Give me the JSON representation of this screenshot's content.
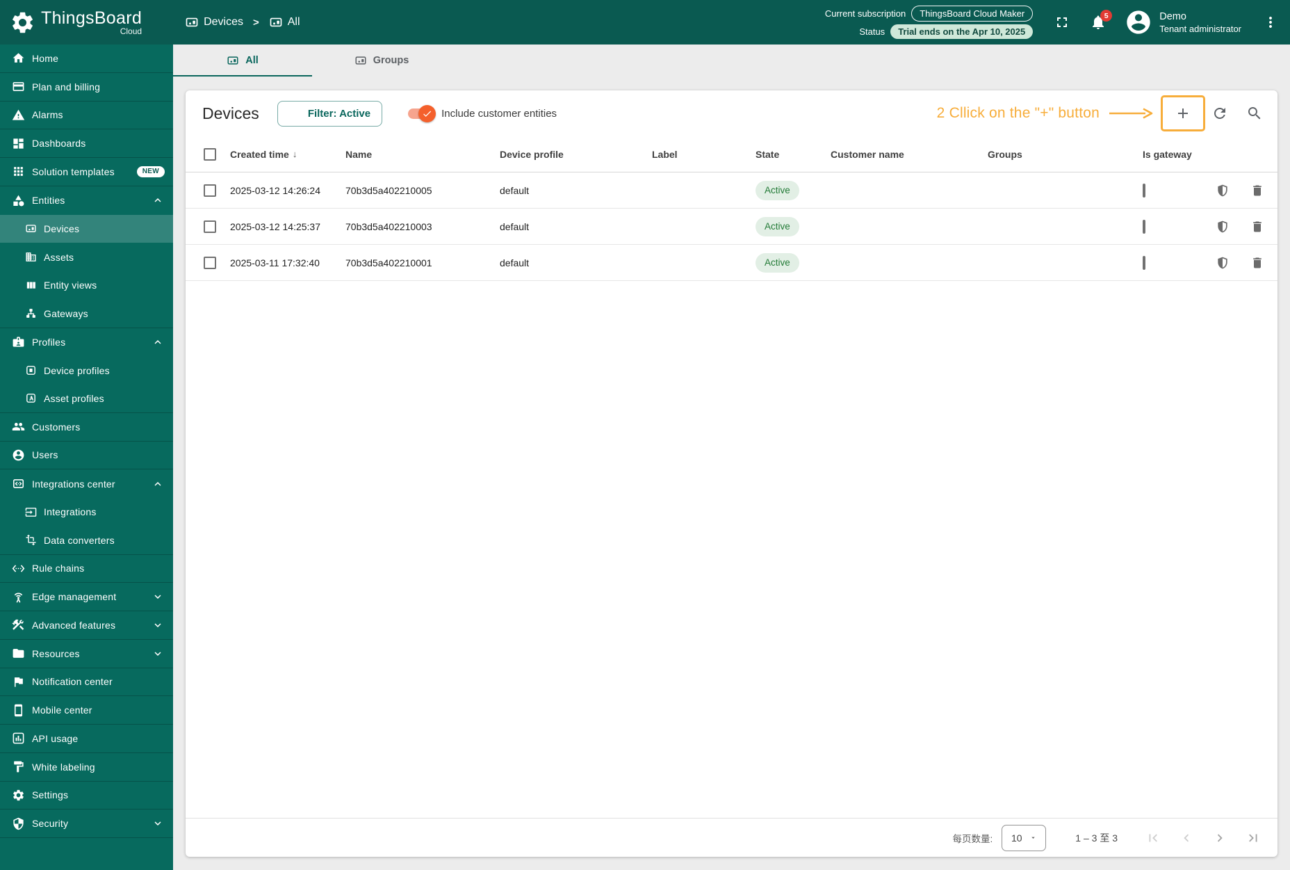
{
  "colors": {
    "header_bg": "#0a5a51",
    "sidebar_bg": "#076a5e",
    "brand_teal": "#09665c",
    "annotation_orange": "#f7ad3a",
    "toggle_track": "#f6a48e",
    "toggle_thumb": "#f4602c",
    "active_chip_bg": "#e2efe5",
    "active_chip_text": "#237b37",
    "badge_red": "#e23b34",
    "status_chip_bg": "#cfe8d9",
    "status_chip_text": "#11493e"
  },
  "header": {
    "logo_title": "ThingsBoard",
    "logo_subtitle": "Cloud",
    "breadcrumb": {
      "level1": "Devices",
      "level2": "All"
    },
    "subscription_label": "Current subscription",
    "subscription_value": "ThingsBoard Cloud Maker",
    "status_label": "Status",
    "status_value": "Trial ends on the Apr 10, 2025",
    "notifications_count": "5",
    "user_name": "Demo",
    "user_role": "Tenant administrator"
  },
  "sidebar": {
    "items": [
      {
        "label": "Home",
        "icon": "home",
        "divider": true
      },
      {
        "label": "Plan and billing",
        "icon": "credit-card",
        "divider": true
      },
      {
        "label": "Alarms",
        "icon": "warning",
        "divider": true
      },
      {
        "label": "Dashboards",
        "icon": "dashboard",
        "divider": true
      },
      {
        "label": "Solution templates",
        "icon": "apps",
        "badge": "NEW",
        "divider": true
      },
      {
        "label": "Entities",
        "icon": "category",
        "chevron": "up"
      },
      {
        "label": "Devices",
        "icon": "devices",
        "sub": true,
        "selected": true
      },
      {
        "label": "Assets",
        "icon": "building",
        "sub": true
      },
      {
        "label": "Entity views",
        "icon": "columns",
        "sub": true
      },
      {
        "label": "Gateways",
        "icon": "hub",
        "sub": true,
        "divider": true
      },
      {
        "label": "Profiles",
        "icon": "badge-card",
        "chevron": "up"
      },
      {
        "label": "Device profiles",
        "icon": "device-profile",
        "sub": true
      },
      {
        "label": "Asset profiles",
        "icon": "asset-profile",
        "sub": true,
        "divider": true
      },
      {
        "label": "Customers",
        "icon": "people",
        "divider": true
      },
      {
        "label": "Users",
        "icon": "account",
        "divider": true
      },
      {
        "label": "Integrations center",
        "icon": "integration",
        "chevron": "up"
      },
      {
        "label": "Integrations",
        "icon": "input",
        "sub": true
      },
      {
        "label": "Data converters",
        "icon": "transform",
        "sub": true,
        "divider": true
      },
      {
        "label": "Rule chains",
        "icon": "ethernet",
        "divider": true
      },
      {
        "label": "Edge management",
        "icon": "antenna",
        "chevron": "down",
        "divider": true
      },
      {
        "label": "Advanced features",
        "icon": "construction",
        "chevron": "down",
        "divider": true
      },
      {
        "label": "Resources",
        "icon": "folder",
        "chevron": "down",
        "divider": true
      },
      {
        "label": "Notification center",
        "icon": "flag",
        "divider": true
      },
      {
        "label": "Mobile center",
        "icon": "phone",
        "divider": true
      },
      {
        "label": "API usage",
        "icon": "api-chart",
        "divider": true
      },
      {
        "label": "White labeling",
        "icon": "paint",
        "divider": true
      },
      {
        "label": "Settings",
        "icon": "gear",
        "divider": true
      },
      {
        "label": "Security",
        "icon": "shield",
        "chevron": "down",
        "divider": true
      }
    ]
  },
  "tabs": [
    {
      "label": "All",
      "active": true
    },
    {
      "label": "Groups",
      "active": false
    }
  ],
  "toolbar": {
    "title": "Devices",
    "filter_label": "Filter: Active",
    "toggle_label": "Include customer entities",
    "toggle_on": true
  },
  "annotation": {
    "text": "2 Cllick on the \"+\" button"
  },
  "table": {
    "columns": [
      {
        "label": "Created time",
        "sorted": "desc"
      },
      {
        "label": "Name"
      },
      {
        "label": "Device profile"
      },
      {
        "label": "Label"
      },
      {
        "label": "State"
      },
      {
        "label": "Customer name"
      },
      {
        "label": "Groups"
      },
      {
        "label": "Is gateway"
      }
    ],
    "rows": [
      {
        "created_time": "2025-03-12 14:26:24",
        "name": "70b3d5a402210005",
        "device_profile": "default",
        "label": "",
        "state": "Active",
        "customer_name": "",
        "groups": "",
        "is_gateway": false
      },
      {
        "created_time": "2025-03-12 14:25:37",
        "name": "70b3d5a402210003",
        "device_profile": "default",
        "label": "",
        "state": "Active",
        "customer_name": "",
        "groups": "",
        "is_gateway": false
      },
      {
        "created_time": "2025-03-11 17:32:40",
        "name": "70b3d5a402210001",
        "device_profile": "default",
        "label": "",
        "state": "Active",
        "customer_name": "",
        "groups": "",
        "is_gateway": false
      }
    ]
  },
  "pagination": {
    "per_page_label": "每页数量:",
    "per_page_value": "10",
    "range_label": "1 – 3 至 3"
  }
}
